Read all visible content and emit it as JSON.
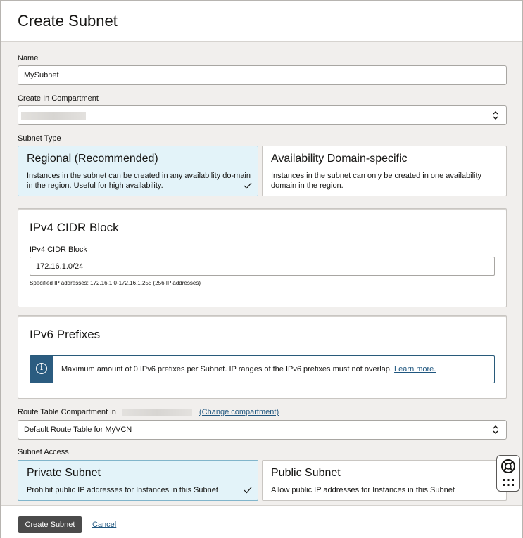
{
  "header": {
    "title": "Create Subnet"
  },
  "form": {
    "name_label": "Name",
    "name_value": "MySubnet",
    "compartment_label": "Create In Compartment",
    "subnet_type_label": "Subnet Type",
    "subnet_types": [
      {
        "title": "Regional (Recommended)",
        "desc": "Instances in the subnet can be created in any availability do-main in the region. Useful for high availability.",
        "selected": true
      },
      {
        "title": "Availability Domain-specific",
        "desc": "Instances in the subnet can only be created in one availability domain in the region.",
        "selected": false
      }
    ],
    "ipv4": {
      "section_title": "IPv4 CIDR Block",
      "field_label": "IPv4 CIDR Block",
      "value": "172.16.1.0/24",
      "hint": "Specified IP addresses: 172.16.1.0-172.16.1.255 (256 IP addresses)"
    },
    "ipv6": {
      "section_title": "IPv6 Prefixes",
      "info_text": "Maximum amount of 0 IPv6 prefixes per Subnet. IP ranges of the IPv6 prefixes must not overlap.",
      "learn_more": "Learn more."
    },
    "route_table": {
      "label": "Route Table Compartment in",
      "change_link": "(Change compartment)",
      "value": "Default Route Table for MyVCN"
    },
    "subnet_access_label": "Subnet Access",
    "subnet_access": [
      {
        "title": "Private Subnet",
        "desc": "Prohibit public IP addresses for Instances in this Subnet",
        "selected": true
      },
      {
        "title": "Public Subnet",
        "desc": "Allow public IP addresses for Instances in this Subnet",
        "selected": false
      }
    ]
  },
  "footer": {
    "create_label": "Create Subnet",
    "cancel_label": "Cancel"
  },
  "colors": {
    "selected_card_bg": "#e3f3f9",
    "info_bar": "#2b5c80",
    "primary_button": "#4b4b4b",
    "link": "#1f567f"
  }
}
